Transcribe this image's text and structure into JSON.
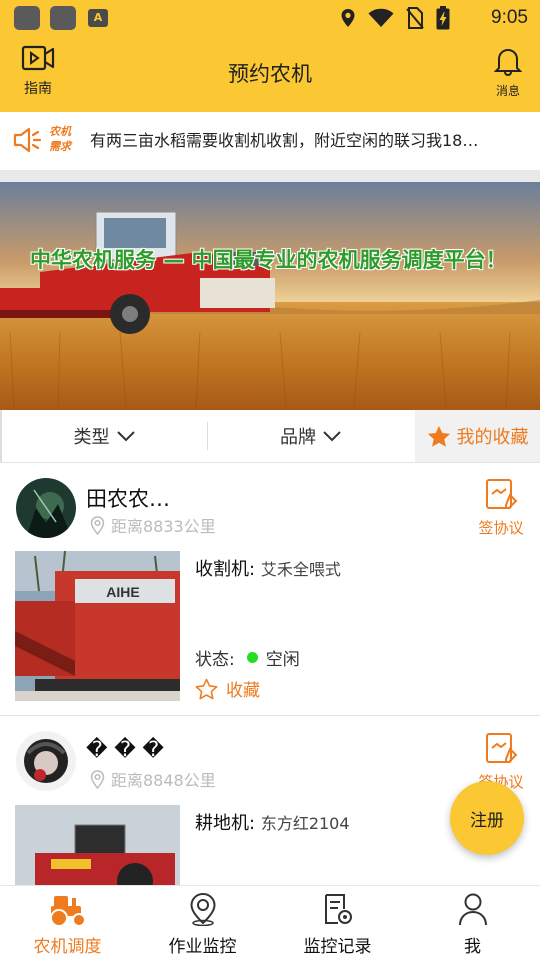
{
  "status_bar": {
    "time": "9:05",
    "app_icon_letter": "A"
  },
  "header": {
    "title": "预约农机",
    "guide_label": "指南",
    "message_label": "消息"
  },
  "notice": {
    "tag_line1": "农机",
    "tag_line2": "需求",
    "text": "有两三亩水稻需要收割机收割，附近空闲的联习我18…"
  },
  "banner": {
    "headline": "中华农机服务 — 中国最专业的农机服务调度平台！"
  },
  "filters": {
    "type_label": "类型",
    "brand_label": "品牌",
    "favorites_label": "我的收藏"
  },
  "listings": [
    {
      "owner": "田农农…",
      "distance": "距离8833公里",
      "sign_label": "签协议",
      "machine_type": "收割机:",
      "model": "艾禾全喂式",
      "status_label": "状态:",
      "status_value": "空闲",
      "favorite_label": "收藏",
      "machine_brand_text": "AIHE"
    },
    {
      "owner": "� � �",
      "distance": "距离8848公里",
      "sign_label": "签协议",
      "machine_type": "耕地机:",
      "model": "东方红2104"
    }
  ],
  "fab": {
    "label": "注册"
  },
  "bottom_nav": [
    {
      "label": "农机调度",
      "icon": "tractor-icon",
      "active": true
    },
    {
      "label": "作业监控",
      "icon": "location-pin-icon",
      "active": false
    },
    {
      "label": "监控记录",
      "icon": "record-document-icon",
      "active": false
    },
    {
      "label": "我",
      "icon": "person-icon",
      "active": false
    }
  ],
  "colors": {
    "primary": "#fbc733",
    "accent": "#f07b1f",
    "status_idle": "#22dd22"
  }
}
